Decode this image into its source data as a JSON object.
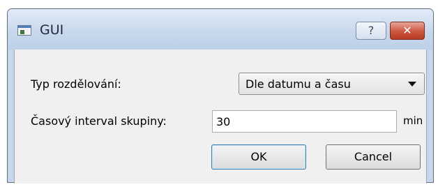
{
  "window": {
    "title": "GUI",
    "help_label": "?",
    "close_label": "✕",
    "icon": "app-window-icon"
  },
  "form": {
    "split_type_label": "Typ rozdělování:",
    "split_type_value": "Dle datumu a času",
    "interval_label": "Časový interval skupiny:",
    "interval_value": "30",
    "interval_unit": "min"
  },
  "buttons": {
    "ok_label": "OK",
    "cancel_label": "Cancel"
  },
  "colors": {
    "titlebar": "#c8d8ec",
    "client": "#f0f0f0",
    "close_button": "#cd5640",
    "default_button_border": "#3c7fb1"
  }
}
